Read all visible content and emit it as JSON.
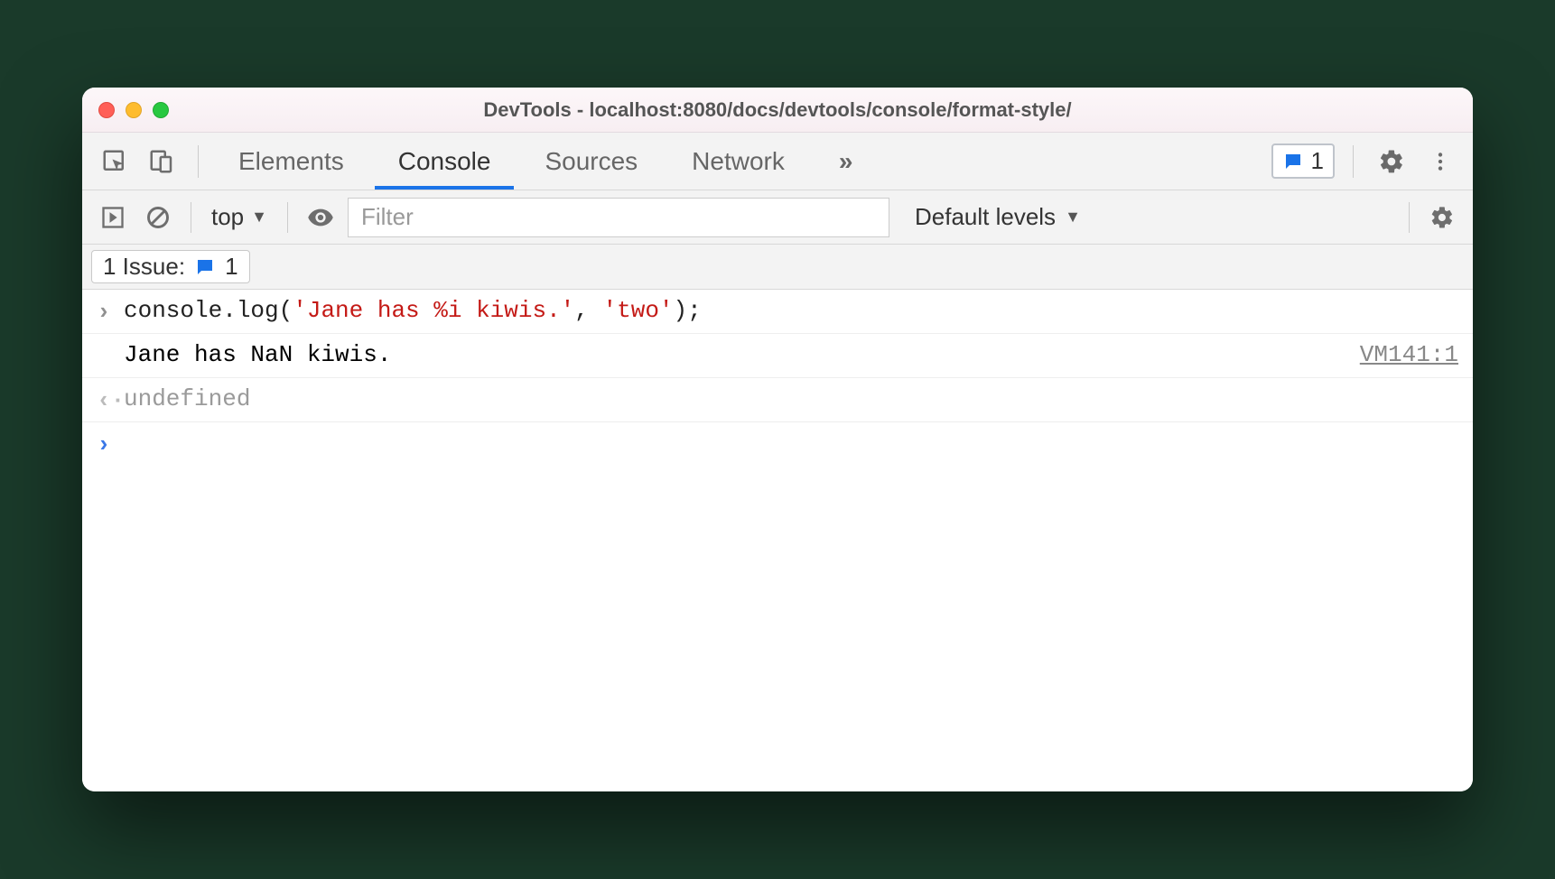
{
  "window": {
    "title": "DevTools - localhost:8080/docs/devtools/console/format-style/"
  },
  "tabs": {
    "items": [
      "Elements",
      "Console",
      "Sources",
      "Network"
    ],
    "overflow_glyph": "»",
    "active_index": 1,
    "issues_badge_count": "1"
  },
  "toolbar": {
    "context": "top",
    "filter_placeholder": "Filter",
    "levels_label": "Default levels"
  },
  "issues_bar": {
    "label": "1 Issue:",
    "count": "1"
  },
  "console_rows": {
    "input": {
      "prefix": "console.log(",
      "str1": "'Jane has %i kiwis.'",
      "sep": ", ",
      "str2": "'two'",
      "suffix": ");"
    },
    "output": {
      "text": "Jane has NaN kiwis.",
      "source": "VM141:1"
    },
    "return": {
      "text": "undefined"
    }
  }
}
